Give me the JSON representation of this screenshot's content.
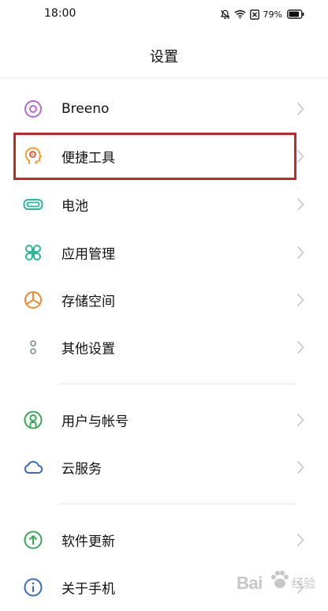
{
  "status_bar": {
    "time": "18:00",
    "battery_percent": "79%",
    "icons": [
      "mute-bell-icon",
      "wifi-icon",
      "sim-off-icon",
      "battery-icon"
    ]
  },
  "page": {
    "title": "设置"
  },
  "groups": [
    {
      "items": [
        {
          "label": "Breeno",
          "icon": "breeno-icon"
        },
        {
          "label": "便捷工具",
          "icon": "convenience-tools-icon"
        },
        {
          "label": "电池",
          "icon": "battery-icon"
        },
        {
          "label": "应用管理",
          "icon": "app-management-icon"
        },
        {
          "label": "存储空间",
          "icon": "storage-icon"
        },
        {
          "label": "其他设置",
          "icon": "other-settings-icon"
        }
      ]
    },
    {
      "items": [
        {
          "label": "用户与帐号",
          "icon": "user-account-icon"
        },
        {
          "label": "云服务",
          "icon": "cloud-icon"
        }
      ]
    },
    {
      "items": [
        {
          "label": "软件更新",
          "icon": "software-update-icon"
        },
        {
          "label": "关于手机",
          "icon": "about-phone-icon"
        }
      ]
    }
  ],
  "colors": {
    "highlight": "#c0282a",
    "breeno": "#b36ad6",
    "tools": "#f0a030",
    "battery": "#2bb59a",
    "apps": "#2bb59a",
    "storage": "#f08a30",
    "other": "#8a96a6",
    "user": "#3aaa5a",
    "cloud": "#3a6ac0",
    "update": "#3aaa5a",
    "about": "#3a6ac0"
  },
  "watermark": {
    "text": "Bai",
    "sub": "经验"
  }
}
